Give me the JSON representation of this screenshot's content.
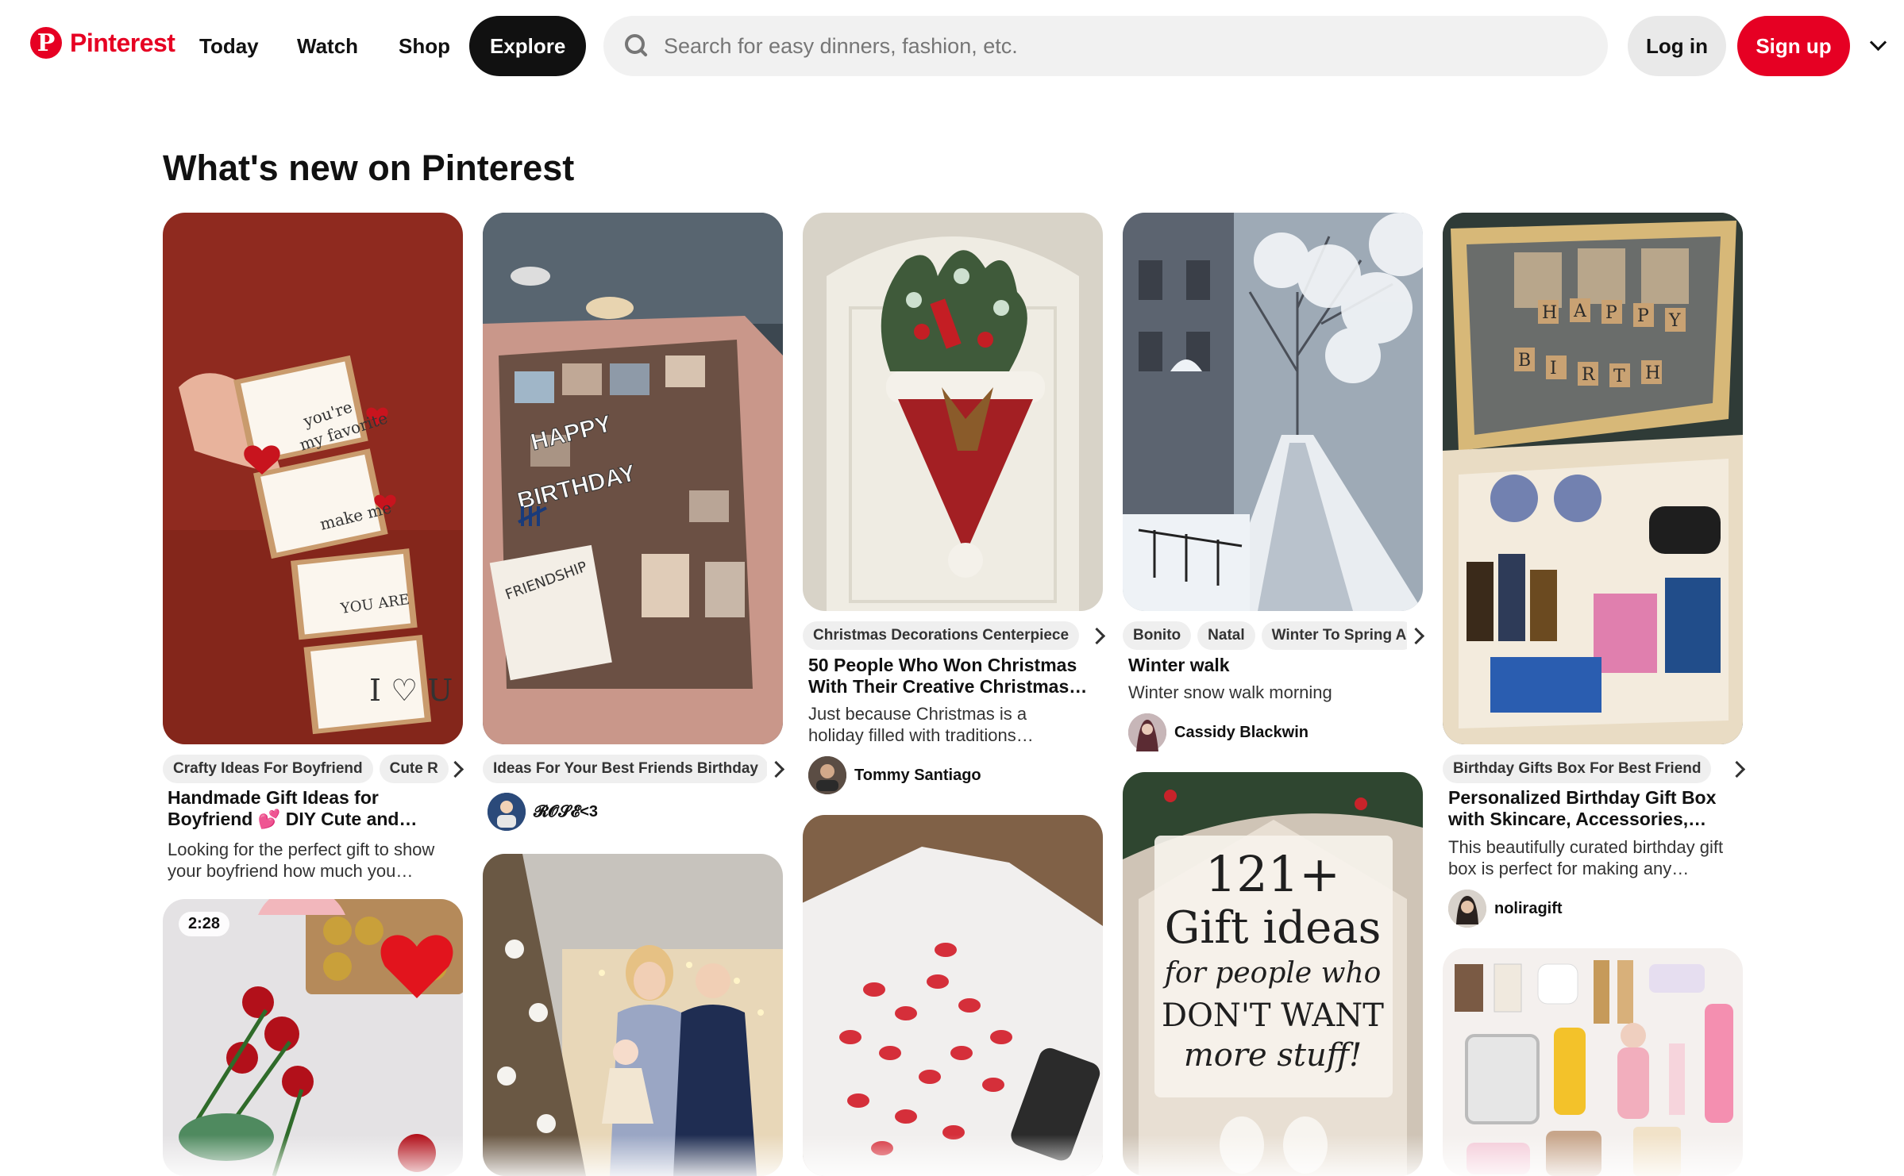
{
  "header": {
    "logo_text": "Pinterest",
    "nav": [
      "Today",
      "Watch",
      "Shop",
      "Explore"
    ],
    "active_nav": "Explore",
    "search_placeholder": "Search for easy dinners, fashion, etc.",
    "login_label": "Log in",
    "signup_label": "Sign up"
  },
  "page_title": "What's new on Pinterest",
  "colors": {
    "brand": "#e60023",
    "chip_bg": "#efefef",
    "search_bg": "#f1f1f1"
  },
  "pins": {
    "p1": {
      "image_alt": "Folded accordion love note card",
      "chips": [
        "Crafty Ideas For Boyfriend",
        "Cute R"
      ],
      "title": "Handmade Gift Ideas for Boyfriend 💕 DIY Cute and…",
      "description": "Looking for the perfect gift to show your boyfriend how much you…"
    },
    "p2": {
      "image_alt": "Valentine roses and chocolates",
      "duration": "2:28"
    },
    "p3": {
      "image_alt": "Happy birthday photo gift box",
      "chips": [
        "Ideas For Your Best Friends Birthday"
      ],
      "user": "𝓡𝓞𝓢𝓔<3"
    },
    "p4": {
      "image_alt": "Family photo in front of Christmas tree"
    },
    "p5": {
      "image_alt": "Santa hat door wreath",
      "chips": [
        "Christmas Decorations Centerpiece"
      ],
      "title": "50 People Who Won Christmas With Their Creative Christmas…",
      "description": "Just because Christmas is a holiday filled with traditions…",
      "user": "Tommy Santiago"
    },
    "p6": {
      "image_alt": "Lipstick kiss print t-shirt"
    },
    "p7": {
      "image_alt": "Snowy street",
      "chips": [
        "Bonito",
        "Natal",
        "Winter To Spring A"
      ],
      "title": "Winter walk",
      "description": "Winter snow walk morning",
      "user": "Cassidy Blackwin"
    },
    "p8": {
      "image_alt": "121+ gift ideas graphic",
      "overlay": [
        "121+",
        "Gift ideas",
        "for people who",
        "DON'T WANT",
        "more stuff!"
      ]
    },
    "p9": {
      "image_alt": "Happy birthday gift box with skincare",
      "chips": [
        "Birthday Gifts Box For Best Friend"
      ],
      "title": "Personalized Birthday Gift Box with Skincare, Accessories, and…",
      "description": "This beautifully curated birthday gift box is perfect for making any…",
      "user": "noliragift"
    },
    "p10": {
      "image_alt": "Skincare products flat lay"
    }
  }
}
